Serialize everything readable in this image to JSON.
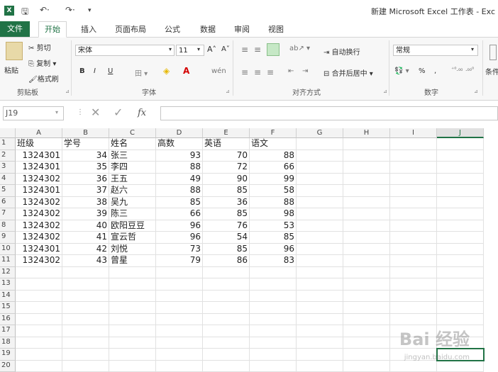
{
  "window": {
    "title": "新建 Microsoft Excel 工作表 - Exc",
    "quick_access": [
      "save-icon",
      "undo-icon",
      "redo-icon"
    ]
  },
  "tabs": [
    "文件",
    "开始",
    "插入",
    "页面布局",
    "公式",
    "数据",
    "审阅",
    "视图"
  ],
  "active_tab": "开始",
  "ribbon": {
    "paste": "粘贴",
    "cut": "剪切",
    "copy": "复制",
    "format_painter": "格式刷",
    "clipboard_label": "剪贴板",
    "font_name": "宋体",
    "font_size": "11",
    "bold": "B",
    "italic": "I",
    "underline": "U",
    "font_label": "字体",
    "wrap_text": "自动换行",
    "merge_center": "合并后居中",
    "alignment_label": "对齐方式",
    "number_format": "常规",
    "percent": "%",
    "number_label": "数字",
    "conditional": "条件"
  },
  "formula_bar": {
    "name_box": "J19",
    "fx": "fx",
    "value": ""
  },
  "columns": [
    "A",
    "B",
    "C",
    "D",
    "E",
    "F",
    "G",
    "H",
    "I",
    "J"
  ],
  "selected_column": "J",
  "selected_cell": "J19",
  "row_numbers": [
    "1",
    "2",
    "3",
    "4",
    "5",
    "6",
    "7",
    "8",
    "9",
    "10",
    "11",
    "12",
    "13",
    "14",
    "15",
    "16",
    "17",
    "18",
    "19",
    "20"
  ],
  "headers": [
    "班级",
    "学号",
    "姓名",
    "高数",
    "英语",
    "语文"
  ],
  "rows": [
    [
      "1324301",
      "34",
      "张三",
      "93",
      "70",
      "88"
    ],
    [
      "1324301",
      "35",
      "李四",
      "88",
      "72",
      "66"
    ],
    [
      "1324302",
      "36",
      "王五",
      "49",
      "90",
      "99"
    ],
    [
      "1324301",
      "37",
      "赵六",
      "88",
      "85",
      "58"
    ],
    [
      "1324302",
      "38",
      "吴九",
      "85",
      "36",
      "88"
    ],
    [
      "1324302",
      "39",
      "陈三",
      "66",
      "85",
      "98"
    ],
    [
      "1324302",
      "40",
      "欧阳豆豆",
      "96",
      "76",
      "53"
    ],
    [
      "1324302",
      "41",
      "宣云哲",
      "96",
      "54",
      "85"
    ],
    [
      "1324301",
      "42",
      "刘悦",
      "73",
      "85",
      "96"
    ],
    [
      "1324302",
      "43",
      "曾星",
      "79",
      "86",
      "83"
    ]
  ],
  "watermark": {
    "logo": "Bai 经验",
    "url": "jingyan.baidu.com"
  },
  "colors": {
    "accent": "#217346"
  }
}
